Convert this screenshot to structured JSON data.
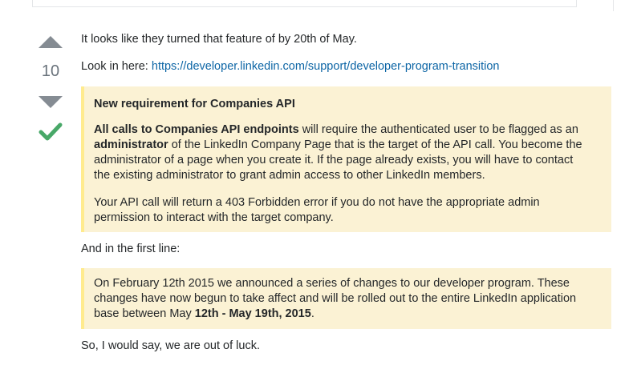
{
  "vote": {
    "count": "10"
  },
  "answer": {
    "p1": "It looks like they turned that feature of by 20th of May.",
    "p2_prefix": "Look in here: ",
    "p2_link": "https://developer.linkedin.com/support/developer-program-transition",
    "quote1": {
      "heading": "New requirement for Companies API",
      "l1_bold": "All calls to Companies API endpoints",
      "l1_rest": " will require the authenticated user to be flagged as an",
      "l2_bold": "administrator",
      "l2_rest": " of the LinkedIn Company Page that is the target of the API call. You become the",
      "l3": "administrator of a page when you create it. If the page already exists, you will have to contact",
      "l4": "the existing administrator to grant admin access to other LinkedIn members.",
      "l5": "Your API call will return a 403 Forbidden error if you do not have the appropriate admin",
      "l6": "permission to interact with the target company."
    },
    "p3": "And in the first line:",
    "quote2": {
      "l1": "On February 12th 2015 we announced a series of changes to our developer program. These",
      "l2": "changes have now begun to take affect and will be rolled out to the entire LinkedIn application",
      "l3_prefix": "base between May ",
      "l3_bold": "12th - May 19th, 2015",
      "l3_suffix": "."
    },
    "p4": "So, I would say, we are out of luck."
  }
}
